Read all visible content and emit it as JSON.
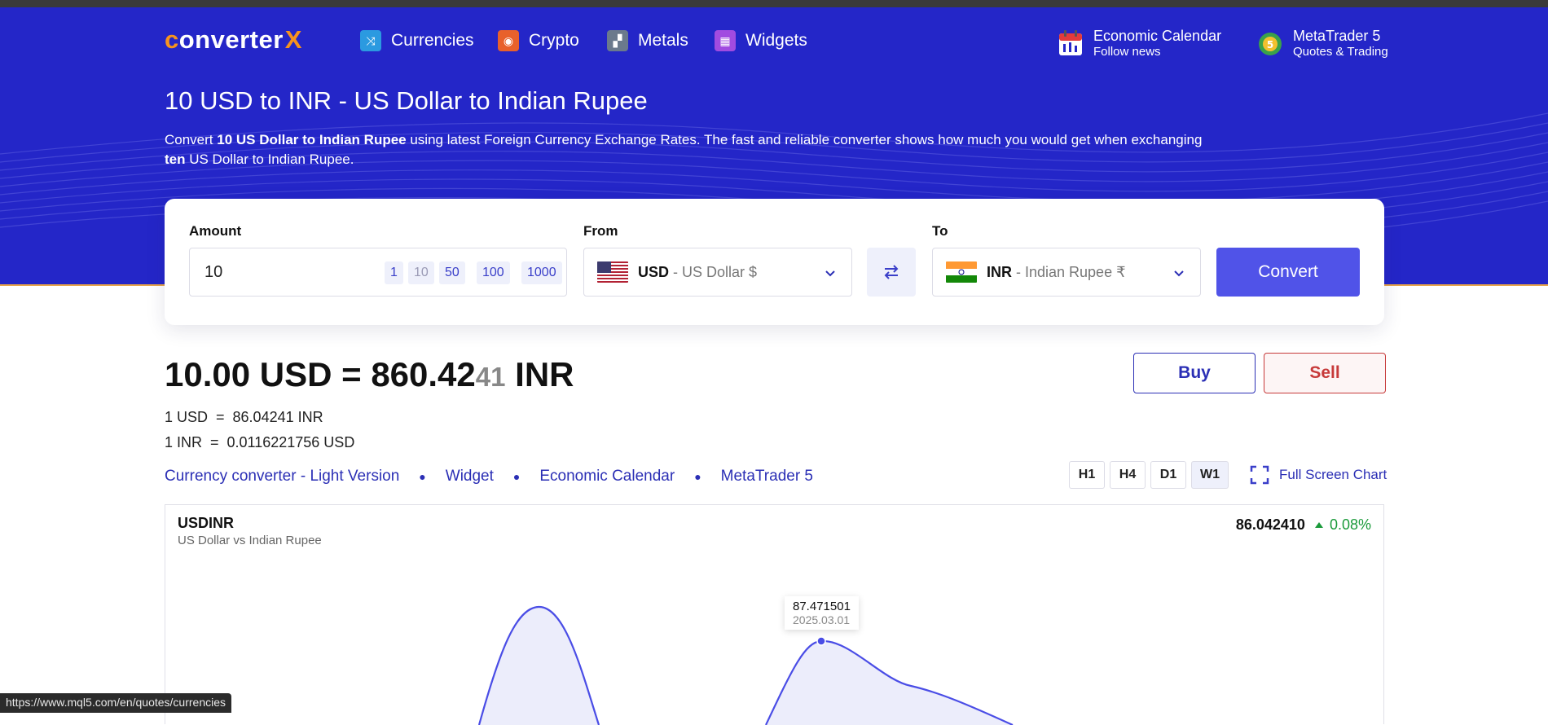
{
  "colors": {
    "hero_bg": "#2426c8",
    "accent": "#5053e8",
    "brand_orange": "#f7931e",
    "buy": "#2b2fb5",
    "sell": "#c73a3a",
    "positive": "#1a9a3a"
  },
  "nav": {
    "logo_c": "c",
    "logo_text": "onverter",
    "logo_x": "X",
    "items": [
      {
        "label": "Currencies",
        "icon": "shuffle-icon",
        "color": "#2b9ae0"
      },
      {
        "label": "Crypto",
        "icon": "crypto-coin-icon",
        "color": "#e8612b"
      },
      {
        "label": "Metals",
        "icon": "gold-bars-icon",
        "color": "#6b7a8c"
      },
      {
        "label": "Widgets",
        "icon": "widgets-grid-icon",
        "color": "#a14be0"
      }
    ],
    "calendar": {
      "title": "Economic Calendar",
      "subtitle": "Follow news"
    },
    "metatrader": {
      "title": "MetaTrader 5",
      "subtitle": "Quotes & Trading"
    }
  },
  "page": {
    "title": "10 USD to INR - US Dollar to Indian Rupee",
    "desc_1": "Convert ",
    "desc_bold_1": "10 US Dollar to Indian Rupee",
    "desc_2": " using latest Foreign Currency Exchange Rates. The fast and reliable converter shows how much you would get when exchanging ",
    "desc_bold_2": "ten",
    "desc_3": " US Dollar to Indian Rupee."
  },
  "converter": {
    "amount_label": "Amount",
    "amount_value": "10",
    "presets": [
      "1",
      "10",
      "50",
      "100",
      "1000"
    ],
    "from_label": "From",
    "from_code": "USD",
    "from_name": "- US Dollar $",
    "to_label": "To",
    "to_code": "INR",
    "to_name": "- Indian Rupee ₹",
    "convert_label": "Convert"
  },
  "result": {
    "main": "10.00 USD = 860.42",
    "small": "41",
    "currency": " INR",
    "rate1": "1 USD  =  86.04241 INR",
    "rate2": "1 INR  =  0.0116221756 USD",
    "buy_label": "Buy",
    "sell_label": "Sell"
  },
  "links": [
    "Currency converter - Light Version",
    "Widget",
    "Economic Calendar",
    "MetaTrader 5"
  ],
  "timeframes": [
    "H1",
    "H4",
    "D1",
    "W1"
  ],
  "active_timeframe": "W1",
  "fullscreen_label": "Full Screen Chart",
  "chart": {
    "symbol": "USDINR",
    "symbol_name": "US Dollar vs Indian Rupee",
    "price": "86.042410",
    "change": "0.08%",
    "tooltip_value": "87.471501",
    "tooltip_date": "2025.03.01"
  },
  "chart_data": {
    "type": "area",
    "series": [
      {
        "values": []
      }
    ],
    "highlight": {
      "x": "2025.03.01",
      "y": 87.471501
    }
  },
  "status_url": "https://www.mql5.com/en/quotes/currencies"
}
